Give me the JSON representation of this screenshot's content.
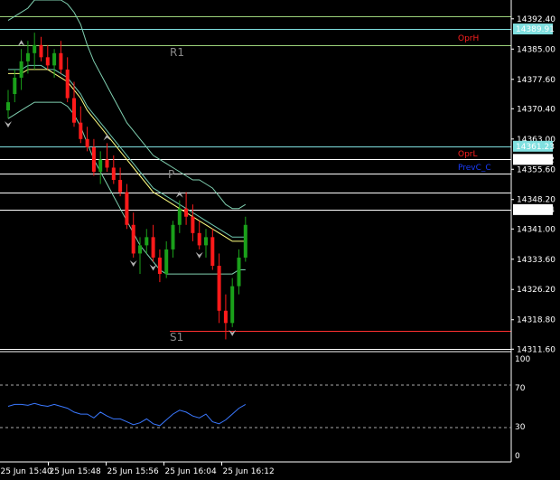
{
  "colors": {
    "background": "#000000",
    "bull": "#1aa01a",
    "bear": "#ff1a1a",
    "band": "#7fcfb0",
    "ma_fast": "#ffff80",
    "ma_slow": "#6fc8b0",
    "rsi": "#3a78ff",
    "white_line": "#ffffff",
    "green_line": "#9bd07a",
    "cyan_line": "#80e0e0",
    "red_line": "#ff3030",
    "price_tag_bg": "#80e0e0",
    "price_tag_white": "#ffffff"
  },
  "price_axis": {
    "ticks": [
      "14392.40",
      "14385.00",
      "14377.60",
      "14370.40",
      "14363.00",
      "14355.60",
      "14348.20",
      "14341.00",
      "14333.60",
      "14326.20",
      "14318.80",
      "14311.60"
    ]
  },
  "price_tags": [
    {
      "id": "tag-r1",
      "label": "14389.91",
      "kind": "cyan"
    },
    {
      "id": "tag-p",
      "label": "14361.23",
      "kind": "cyan"
    },
    {
      "id": "tag-oprl",
      "label": "14358.02",
      "kind": "white"
    },
    {
      "id": "tag-last",
      "label": "14345.74",
      "kind": "white"
    }
  ],
  "level_labels": {
    "oprh": "OprH",
    "oprl": "OprL",
    "prevc": "PrevC_C",
    "r1": "R1",
    "p": "P",
    "s1": "S1"
  },
  "rsi_axis": {
    "ticks": [
      "100",
      "70",
      "30",
      "0"
    ]
  },
  "time_axis": {
    "ticks": [
      "25 Jun 15:40",
      "25 Jun 15:48",
      "25 Jun 15:56",
      "25 Jun 16:04",
      "25 Jun 16:12"
    ]
  },
  "chart_data": {
    "type": "candlestick",
    "ylim": [
      14311,
      14397
    ],
    "series": [
      {
        "name": "candles",
        "ohlc": [
          [
            14370,
            14375,
            14368,
            14372
          ],
          [
            14374,
            14380,
            14372,
            14378
          ],
          [
            14378,
            14385,
            14375,
            14382
          ],
          [
            14382,
            14387,
            14379,
            14384
          ],
          [
            14384,
            14389,
            14380,
            14386
          ],
          [
            14386,
            14388,
            14382,
            14383
          ],
          [
            14383,
            14386,
            14380,
            14381
          ],
          [
            14381,
            14385,
            14378,
            14384
          ],
          [
            14384,
            14387,
            14379,
            14380
          ],
          [
            14380,
            14383,
            14372,
            14373
          ],
          [
            14373,
            14377,
            14366,
            14367
          ],
          [
            14367,
            14371,
            14362,
            14363
          ],
          [
            14363,
            14366,
            14360,
            14361
          ],
          [
            14361,
            14363,
            14354,
            14355
          ],
          [
            14355,
            14360,
            14352,
            14358
          ],
          [
            14358,
            14362,
            14355,
            14356
          ],
          [
            14356,
            14359,
            14352,
            14353
          ],
          [
            14353,
            14356,
            14349,
            14350
          ],
          [
            14350,
            14352,
            14341,
            14342
          ],
          [
            14342,
            14345,
            14334,
            14335
          ],
          [
            14335,
            14339,
            14330,
            14337
          ],
          [
            14337,
            14341,
            14335,
            14339
          ],
          [
            14339,
            14342,
            14333,
            14334
          ],
          [
            14334,
            14336,
            14328,
            14330
          ],
          [
            14330,
            14338,
            14329,
            14336
          ],
          [
            14336,
            14343,
            14334,
            14342
          ],
          [
            14342,
            14348,
            14340,
            14346
          ],
          [
            14346,
            14350,
            14342,
            14344
          ],
          [
            14344,
            14347,
            14338,
            14340
          ],
          [
            14340,
            14343,
            14336,
            14337
          ],
          [
            14337,
            14341,
            14334,
            14339
          ],
          [
            14339,
            14341,
            14331,
            14332
          ],
          [
            14332,
            14335,
            14318,
            14321
          ],
          [
            14321,
            14325,
            14314,
            14318
          ],
          [
            14318,
            14329,
            14317,
            14327
          ],
          [
            14327,
            14336,
            14325,
            14334
          ],
          [
            14334,
            14344,
            14333,
            14342
          ]
        ]
      },
      {
        "name": "upper_band",
        "values": [
          14392,
          14393,
          14394,
          14395,
          14397,
          14397,
          14397,
          14397,
          14397,
          14396,
          14394,
          14391,
          14386,
          14382,
          14379,
          14376,
          14373,
          14370,
          14367,
          14365,
          14363,
          14361,
          14359,
          14358,
          14357,
          14356,
          14355,
          14354,
          14353,
          14353,
          14352,
          14351,
          14349,
          14347,
          14346,
          14346,
          14347
        ]
      },
      {
        "name": "lower_band",
        "values": [
          14368,
          14369,
          14370,
          14371,
          14372,
          14372,
          14372,
          14372,
          14372,
          14371,
          14369,
          14366,
          14362,
          14358,
          14355,
          14352,
          14349,
          14346,
          14343,
          14340,
          14337,
          14335,
          14333,
          14331,
          14330,
          14330,
          14330,
          14330,
          14330,
          14330,
          14330,
          14330,
          14330,
          14330,
          14330,
          14331,
          14331
        ]
      },
      {
        "name": "ma_fast",
        "values": [
          14379,
          14379,
          14379,
          14380,
          14380,
          14380,
          14380,
          14379,
          14378,
          14377,
          14375,
          14373,
          14370,
          14368,
          14366,
          14364,
          14362,
          14360,
          14358,
          14356,
          14354,
          14352,
          14350,
          14349,
          14348,
          14347,
          14346,
          14345,
          14344,
          14343,
          14342,
          14341,
          14340,
          14339,
          14338,
          14338,
          14338
        ]
      },
      {
        "name": "ma_slow",
        "values": [
          14380,
          14380,
          14380,
          14381,
          14381,
          14381,
          14380,
          14380,
          14379,
          14378,
          14376,
          14374,
          14371,
          14369,
          14367,
          14365,
          14363,
          14361,
          14359,
          14357,
          14355,
          14353,
          14351,
          14350,
          14349,
          14348,
          14347,
          14346,
          14345,
          14344,
          14343,
          14342,
          14341,
          14340,
          14339,
          14339,
          14339
        ]
      },
      {
        "name": "rsi",
        "values": [
          50,
          52,
          52,
          51,
          53,
          51,
          50,
          52,
          50,
          48,
          44,
          42,
          42,
          38,
          44,
          40,
          37,
          37,
          34,
          31,
          33,
          37,
          32,
          30,
          36,
          42,
          46,
          44,
          40,
          38,
          42,
          34,
          32,
          36,
          42,
          48,
          52
        ]
      }
    ],
    "levels": [
      {
        "name": "level-green-top",
        "value": 14393,
        "color": "#9bd07a"
      },
      {
        "name": "level-r1",
        "value": 14389.91,
        "color": "#80e0e0"
      },
      {
        "name": "level-oprh",
        "value": 14386,
        "color": "#9bd07a"
      },
      {
        "name": "level-p",
        "value": 14361.23,
        "color": "#80e0e0"
      },
      {
        "name": "level-oprl",
        "value": 14358.02,
        "color": "#ffffff"
      },
      {
        "name": "level-prevc",
        "value": 14354.5,
        "color": "#ffffff"
      },
      {
        "name": "level-white-mid",
        "value": 14350,
        "color": "#ffffff"
      },
      {
        "name": "level-last",
        "value": 14345.74,
        "color": "#ffffff"
      },
      {
        "name": "level-s1",
        "value": 14316,
        "color": "#ff3030"
      },
      {
        "name": "level-bottom",
        "value": 14311.6,
        "color": "#ffffff"
      }
    ]
  }
}
